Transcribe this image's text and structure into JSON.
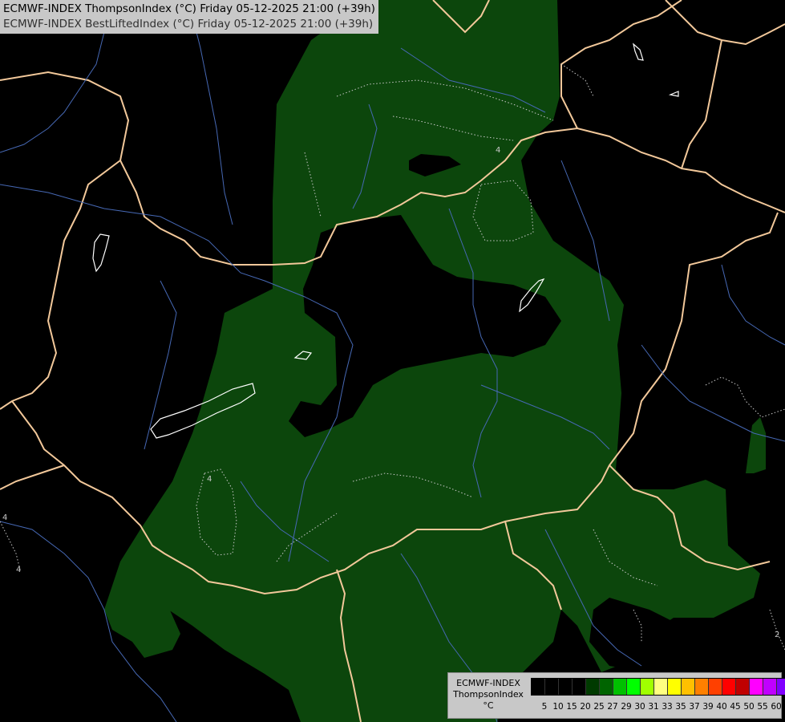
{
  "title": {
    "line1": "ECMWF-INDEX ThompsonIndex (°C) Friday 05-12-2025 21:00 (+39h)",
    "line2": "ECMWF-INDEX BestLiftedIndex (°C) Friday 05-12-2025 21:00 (+39h)"
  },
  "legend": {
    "model": "ECMWF-INDEX",
    "parameter": "ThompsonIndex",
    "unit": "°C",
    "ticks": [
      "5",
      "10",
      "15",
      "20",
      "25",
      "27",
      "29",
      "30",
      "31",
      "33",
      "35",
      "37",
      "39",
      "40",
      "45",
      "50",
      "55",
      "60"
    ],
    "colors": [
      "#000000",
      "#000000",
      "#000000",
      "#000000",
      "#003a00",
      "#006400",
      "#00c000",
      "#00ff00",
      "#a0ff00",
      "#ffff80",
      "#ffff00",
      "#ffc000",
      "#ff8000",
      "#ff4000",
      "#ff0000",
      "#c00000",
      "#ff00ff",
      "#c000ff",
      "#8000ff",
      "#4000ff",
      "#0000ff"
    ]
  },
  "map": {
    "contour_labels": [
      "4",
      "4",
      "4",
      "4",
      "2"
    ]
  },
  "colors": {
    "positive_region": "#0c460c",
    "border": "#f2c89a",
    "river": "#4668b4",
    "lake": "#ffffff",
    "contour": "#c8c8c8"
  }
}
